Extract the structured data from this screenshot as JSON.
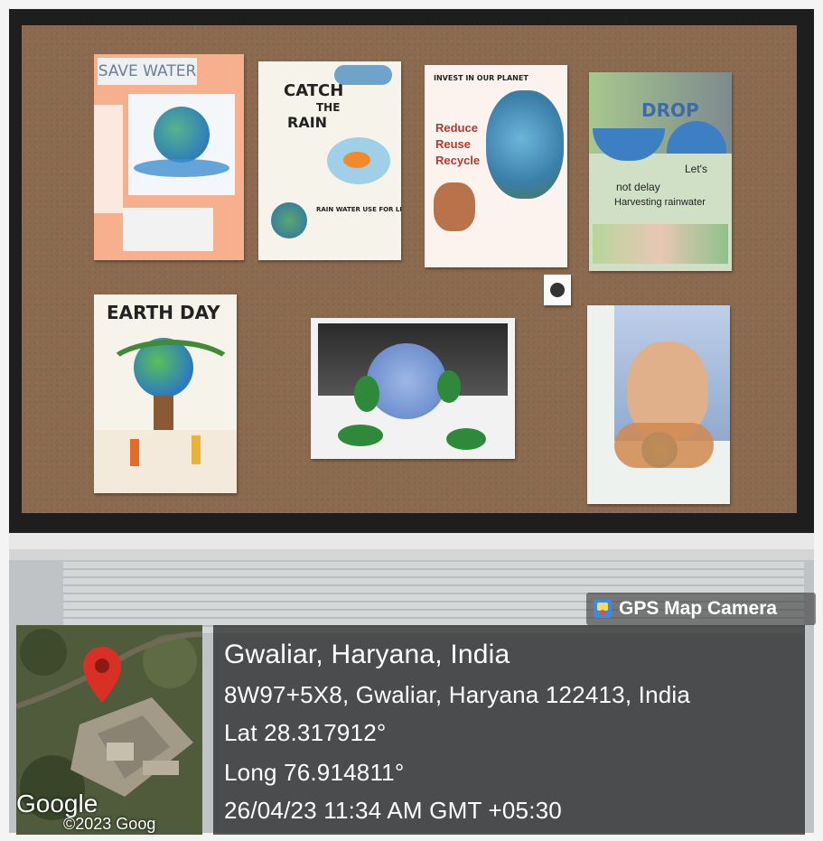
{
  "posters": {
    "save_water": {
      "title": "SAVE WATER"
    },
    "catch_rain": {
      "title_1": "CATCH",
      "title_2": "THE",
      "title_3": "RAIN",
      "caption": "RAIN WATER USE FOR LIFE"
    },
    "planet": {
      "title": "INVEST IN OUR PLANET",
      "words": [
        "Reduce",
        "Reuse",
        "Recycle"
      ]
    },
    "drop": {
      "title": "DROP",
      "words": [
        "Let's",
        "not delay",
        "Harvesting rainwater"
      ]
    },
    "earth_day": {
      "title": "EARTH DAY"
    },
    "globe_night": {
      "title": ""
    },
    "face": {
      "title": ""
    }
  },
  "overlay": {
    "badge_label": "GPS Map Camera",
    "badge_icon": "gps-map-camera-icon",
    "map_brand": "Google",
    "map_copyright": "©2023 Goog",
    "location_title": "Gwaliar, Haryana, India",
    "address": "8W97+5X8, Gwaliar, Haryana 122413, India",
    "latitude": "Lat 28.317912°",
    "longitude": "Long 76.914811°",
    "timestamp": "26/04/23 11:34 AM GMT +05:30",
    "pin_color": "#d93025"
  }
}
